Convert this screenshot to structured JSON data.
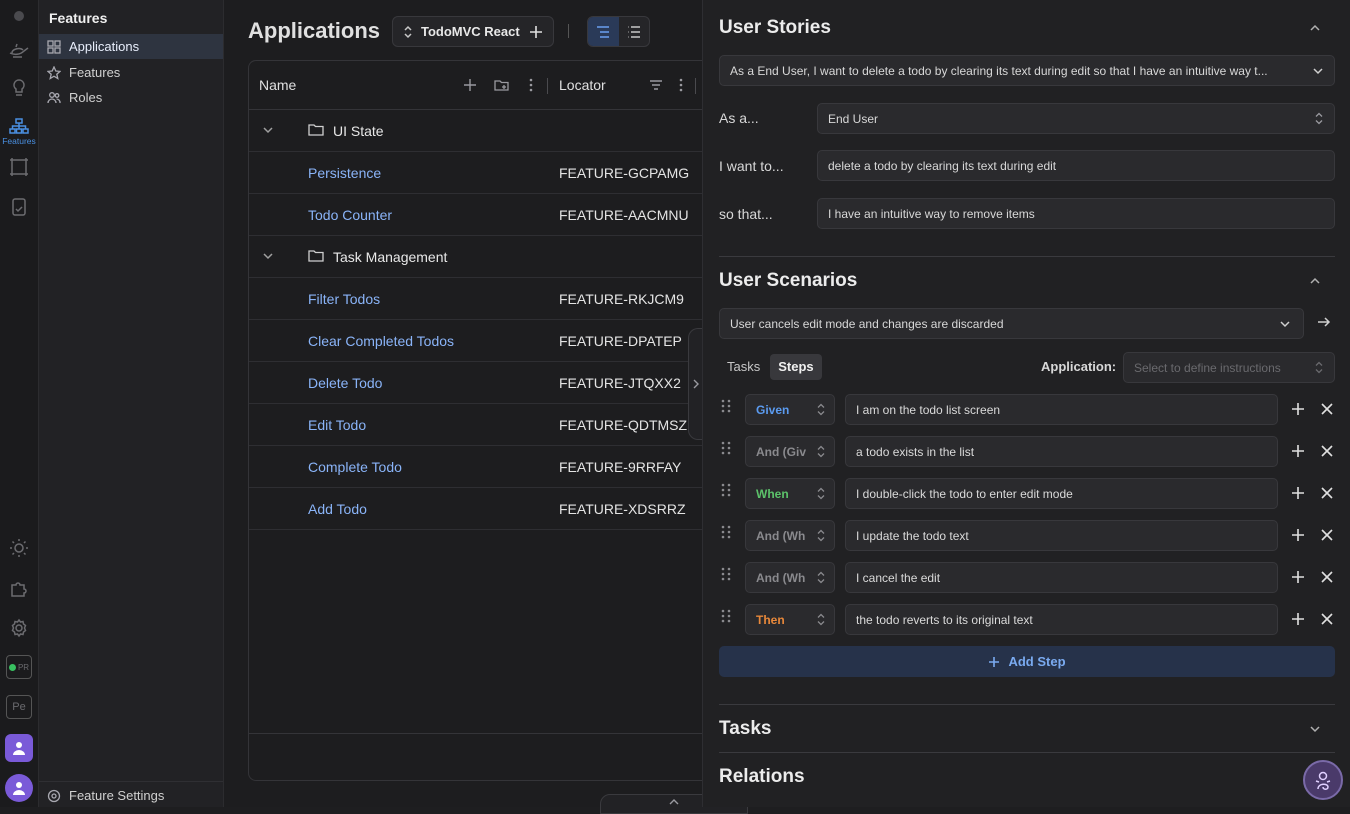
{
  "sidebar": {
    "title": "Features",
    "items": [
      {
        "label": "Applications",
        "icon": "grid-icon",
        "active": true
      },
      {
        "label": "Features",
        "icon": "star-icon"
      },
      {
        "label": "Roles",
        "icon": "users-icon"
      }
    ],
    "settings_label": "Feature Settings"
  },
  "activity": {
    "features_label": "Features",
    "pr_label": "PR",
    "pe_label": "Pe"
  },
  "main": {
    "title": "Applications",
    "app_selector": "TodoMVC React",
    "columns": {
      "name": "Name",
      "locator": "Locator"
    },
    "rows": [
      {
        "type": "folder",
        "name": "UI State",
        "locator": ""
      },
      {
        "type": "feature",
        "name": "Persistence",
        "locator": "FEATURE-GCPAMG"
      },
      {
        "type": "feature",
        "name": "Todo Counter",
        "locator": "FEATURE-AACMNU"
      },
      {
        "type": "folder",
        "name": "Task Management",
        "locator": ""
      },
      {
        "type": "feature",
        "name": "Filter Todos",
        "locator": "FEATURE-RKJCM9"
      },
      {
        "type": "feature",
        "name": "Clear Completed Todos",
        "locator": "FEATURE-DPATEP"
      },
      {
        "type": "feature",
        "name": "Delete Todo",
        "locator": "FEATURE-JTQXX2"
      },
      {
        "type": "feature",
        "name": "Edit Todo",
        "locator": "FEATURE-QDTMSZ"
      },
      {
        "type": "feature",
        "name": "Complete Todo",
        "locator": "FEATURE-9RRFAY"
      },
      {
        "type": "feature",
        "name": "Add Todo",
        "locator": "FEATURE-XDSRRZ"
      }
    ]
  },
  "panel": {
    "user_stories": {
      "title": "User Stories",
      "selected_story": "As a End User, I want to delete a todo by clearing its text during edit so that I have an intuitive way t...",
      "as_a_label": "As a...",
      "as_a_value": "End User",
      "want_label": "I want to...",
      "want_value": "delete a todo by clearing its text during edit",
      "so_that_label": "so that...",
      "so_that_value": "I have an intuitive way to remove items"
    },
    "user_scenarios": {
      "title": "User Scenarios",
      "selected_scenario": "User cancels edit mode and changes are discarded",
      "tabs": [
        "Tasks",
        "Steps"
      ],
      "application_label": "Application:",
      "application_placeholder": "Select to define instructions",
      "steps": [
        {
          "keyword": "Given",
          "color": "#5b9bf0",
          "text": "I am on the todo list screen"
        },
        {
          "keyword": "And (Giv",
          "color": "#8a8a8e",
          "text": "a todo exists in the list"
        },
        {
          "keyword": "When",
          "color": "#5cc26a",
          "text": "I double-click the todo to enter edit mode"
        },
        {
          "keyword": "And (Wh",
          "color": "#8a8a8e",
          "text": "I update the todo text"
        },
        {
          "keyword": "And (Wh",
          "color": "#8a8a8e",
          "text": "I cancel the edit"
        },
        {
          "keyword": "Then",
          "color": "#e8883a",
          "text": "the todo reverts to its original text"
        }
      ],
      "add_step_label": "Add Step"
    },
    "tasks_title": "Tasks",
    "relations_title": "Relations"
  }
}
